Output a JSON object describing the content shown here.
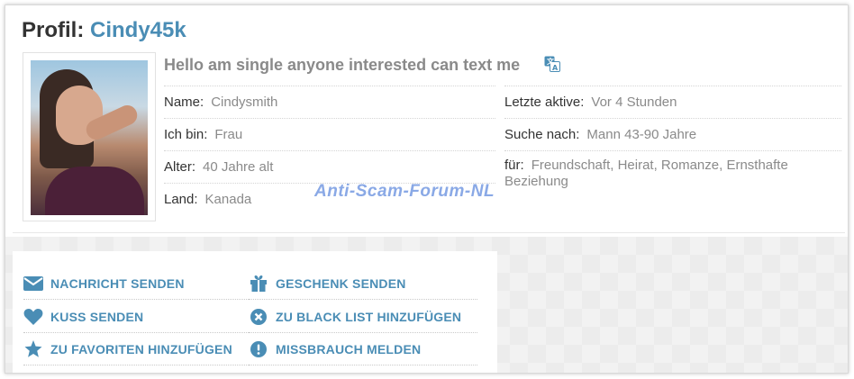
{
  "profile": {
    "title_prefix": "Profil:",
    "username": "Cindy45k",
    "headline": "Hello am single anyone interested can text me"
  },
  "info": {
    "name_label": "Name:",
    "name_value": "Cindysmith",
    "iam_label": "Ich bin:",
    "iam_value": "Frau",
    "age_label": "Alter:",
    "age_value": "40 Jahre alt",
    "country_label": "Land:",
    "country_value": "Kanada",
    "last_active_label": "Letzte aktive:",
    "last_active_value": "Vor 4 Stunden",
    "seeking_label": "Suche nach:",
    "seeking_value": "Mann 43-90 Jahre",
    "for_label": "für:",
    "for_value": "Freundschaft, Heirat, Romanze, Ernsthafte Beziehung"
  },
  "watermark": "Anti-Scam-Forum-NL",
  "actions": {
    "send_message": "NACHRICHT SENDEN",
    "send_kiss": "KUSS SENDEN",
    "add_favorites": "ZU FAVORITEN HINZUFÜGEN",
    "send_gift": "GESCHENK SENDEN",
    "add_blacklist": "ZU BLACK LIST HINZUFÜGEN",
    "report_abuse": "MISSBRAUCH MELDEN"
  },
  "icons": {
    "message": "envelope-icon",
    "kiss": "heart-icon",
    "favorites": "star-icon",
    "gift": "gift-icon",
    "blacklist": "close-circle-icon",
    "report": "exclamation-circle-icon",
    "translate": "translate-icon"
  },
  "colors": {
    "accent": "#4a8db5",
    "muted_text": "#8a8a8a",
    "watermark": "#8aa9e6"
  }
}
